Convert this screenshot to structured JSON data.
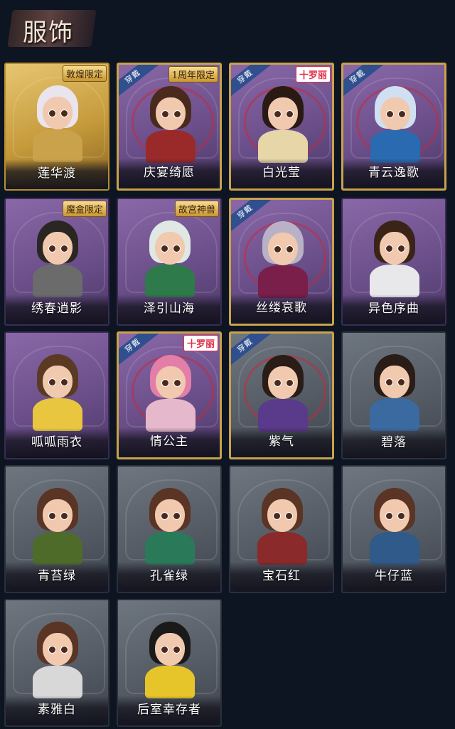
{
  "header": {
    "title": "服饰"
  },
  "cards": [
    {
      "name": "莲华渡",
      "theme": "gold",
      "badge": "敦煌限定",
      "badge_style": "gold",
      "equipped": false,
      "hair": "#e9e4ee",
      "body": "#c9a24b"
    },
    {
      "name": "庆宴绮愿",
      "theme": "purple",
      "badge": "1周年限定",
      "badge_style": "gold",
      "equipped": true,
      "ribbon": "穿戴",
      "hair": "#4a2a1c",
      "body": "#9a2a2a"
    },
    {
      "name": "白光莹",
      "theme": "purple",
      "badge": "十罗丽",
      "badge_style": "red",
      "equipped": true,
      "ribbon": "穿戴",
      "hair": "#2a1a14",
      "body": "#e6d6a8"
    },
    {
      "name": "青云逸歌",
      "theme": "purple",
      "badge": "",
      "badge_style": "",
      "equipped": true,
      "ribbon": "穿戴",
      "hair": "#cfe0f2",
      "body": "#2a6ab0"
    },
    {
      "name": "绣春逍影",
      "theme": "purple",
      "badge": "魔盒限定",
      "badge_style": "gold",
      "equipped": false,
      "hair": "#2a2622",
      "body": "#6b6b6b"
    },
    {
      "name": "泽引山海",
      "theme": "purple",
      "badge": "故宫神兽",
      "badge_style": "gold",
      "equipped": false,
      "hair": "#dfe8e4",
      "body": "#2f7a4a"
    },
    {
      "name": "丝缕哀歌",
      "theme": "purple",
      "badge": "",
      "badge_style": "",
      "equipped": true,
      "ribbon": "穿戴",
      "hair": "#b9b2c6",
      "body": "#7a1f4a"
    },
    {
      "name": "异色序曲",
      "theme": "purple",
      "badge": "",
      "badge_style": "",
      "equipped": false,
      "hair": "#3a2418",
      "body": "#e8e8ea"
    },
    {
      "name": "呱呱雨衣",
      "theme": "purple",
      "badge": "",
      "badge_style": "",
      "equipped": false,
      "hair": "#5a3a22",
      "body": "#e8c640"
    },
    {
      "name": "情公主",
      "theme": "purple",
      "badge": "十罗丽",
      "badge_style": "red",
      "equipped": true,
      "ribbon": "穿戴",
      "hair": "#e27ea8",
      "body": "#e6b8cc"
    },
    {
      "name": "紫气",
      "theme": "gray",
      "badge": "",
      "badge_style": "",
      "equipped": true,
      "ribbon": "穿戴",
      "hair": "#2a1c16",
      "body": "#5a3a8a"
    },
    {
      "name": "碧落",
      "theme": "gray",
      "badge": "",
      "badge_style": "",
      "equipped": false,
      "hair": "#2a1c16",
      "body": "#3a6aa0"
    },
    {
      "name": "青苔绿",
      "theme": "gray",
      "badge": "",
      "badge_style": "",
      "equipped": false,
      "hair": "#5a3424",
      "body": "#4f6b2a"
    },
    {
      "name": "孔雀绿",
      "theme": "gray",
      "badge": "",
      "badge_style": "",
      "equipped": false,
      "hair": "#5a3424",
      "body": "#2a7a5a"
    },
    {
      "name": "宝石红",
      "theme": "gray",
      "badge": "",
      "badge_style": "",
      "equipped": false,
      "hair": "#5a3424",
      "body": "#8a2a2a"
    },
    {
      "name": "牛仔蓝",
      "theme": "gray",
      "badge": "",
      "badge_style": "",
      "equipped": false,
      "hair": "#5a3424",
      "body": "#2f5a8a"
    },
    {
      "name": "素雅白",
      "theme": "gray",
      "badge": "",
      "badge_style": "",
      "equipped": false,
      "hair": "#5a3424",
      "body": "#d8d8d8"
    },
    {
      "name": "后室幸存者",
      "theme": "gray",
      "badge": "",
      "badge_style": "",
      "equipped": false,
      "hair": "#1a1a1a",
      "body": "#e6c52a"
    }
  ]
}
